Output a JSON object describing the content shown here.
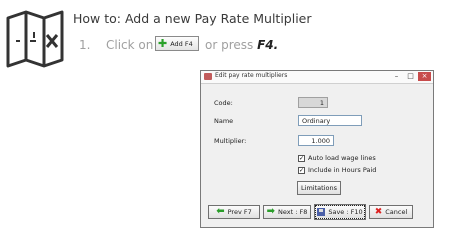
{
  "instruction": {
    "heading": "How to: Add a new Pay Rate Multiplier",
    "step_number": "1.",
    "step_prefix": "Click on",
    "inline_button_label": "Add F4",
    "step_suffix": "or press",
    "step_key": "F4."
  },
  "dialog": {
    "title": "Edit pay rate multipliers",
    "window_controls": {
      "minimize": "–",
      "maximize": "□",
      "close": "×"
    },
    "code_label": "Code:",
    "code_value": "1",
    "name_label": "Name",
    "name_value": "Ordinary",
    "multiplier_label": "Multiplier:",
    "multiplier_value": "1.000",
    "auto_load_label": "Auto load wage lines",
    "auto_load_checked": true,
    "include_hours_label": "Include in Hours Paid",
    "include_hours_checked": true,
    "limitations_label": "Limitations",
    "buttons": {
      "prev": "Prev  F7",
      "next": "Next : F8",
      "save": "Save : F10",
      "cancel": "Cancel"
    }
  },
  "colors": {
    "accent_green": "#2a9d2a",
    "cancel_red": "#dd2222"
  },
  "icons": {
    "heading_icon": "map-icon",
    "inline_button_icon": "plus-icon"
  }
}
